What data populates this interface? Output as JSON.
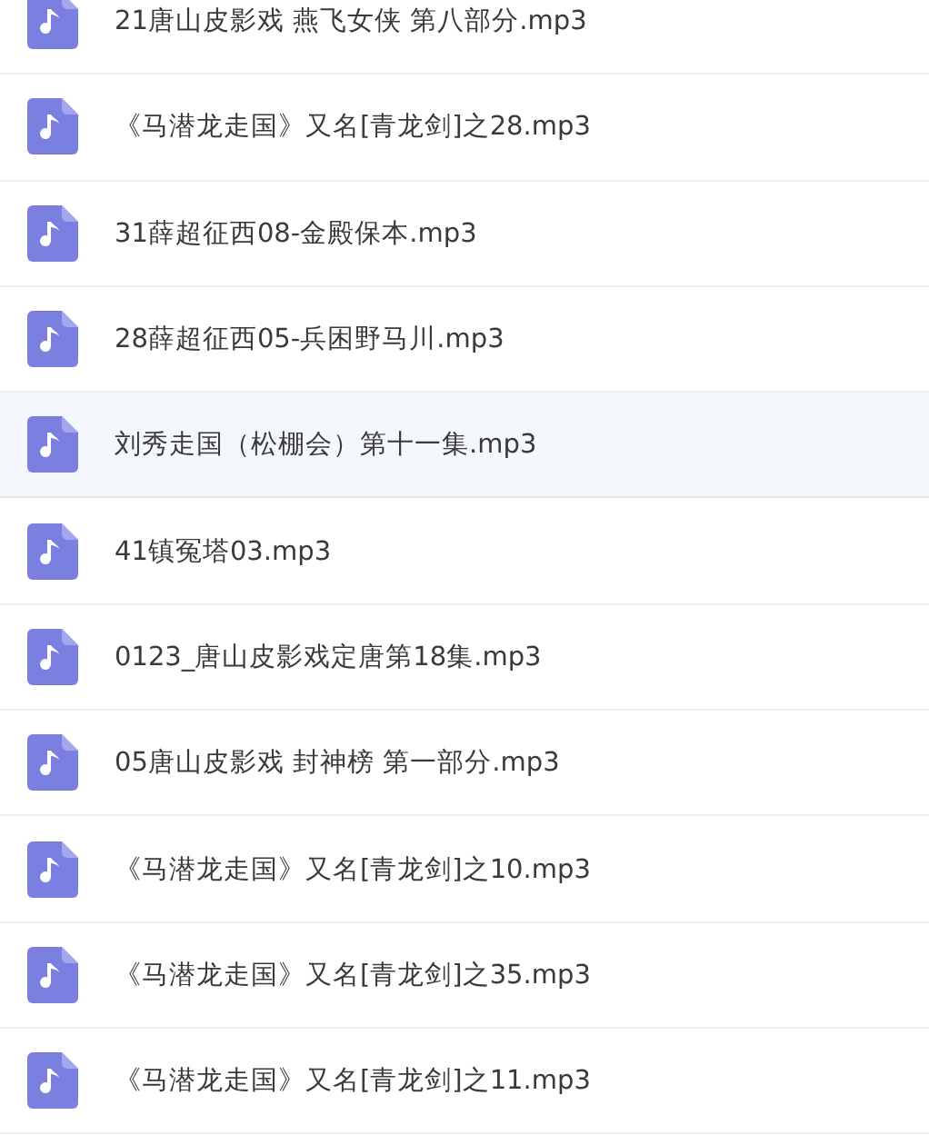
{
  "files": [
    {
      "name": "21唐山皮影戏 燕飞女侠 第八部分.mp3",
      "selected": false
    },
    {
      "name": "《马潜龙走国》又名[青龙剑]之28.mp3",
      "selected": false
    },
    {
      "name": "31薛超征西08-金殿保本.mp3",
      "selected": false
    },
    {
      "name": "28薛超征西05-兵困野马川.mp3",
      "selected": false
    },
    {
      "name": "刘秀走国（松棚会）第十一集.mp3",
      "selected": true
    },
    {
      "name": "41镇冤塔03.mp3",
      "selected": false
    },
    {
      "name": "0123_唐山皮影戏定唐第18集.mp3",
      "selected": false
    },
    {
      "name": "05唐山皮影戏 封神榜 第一部分.mp3",
      "selected": false
    },
    {
      "name": "《马潜龙走国》又名[青龙剑]之10.mp3",
      "selected": false
    },
    {
      "name": "《马潜龙走国》又名[青龙剑]之35.mp3",
      "selected": false
    },
    {
      "name": "《马潜龙走国》又名[青龙剑]之11.mp3",
      "selected": false
    }
  ]
}
